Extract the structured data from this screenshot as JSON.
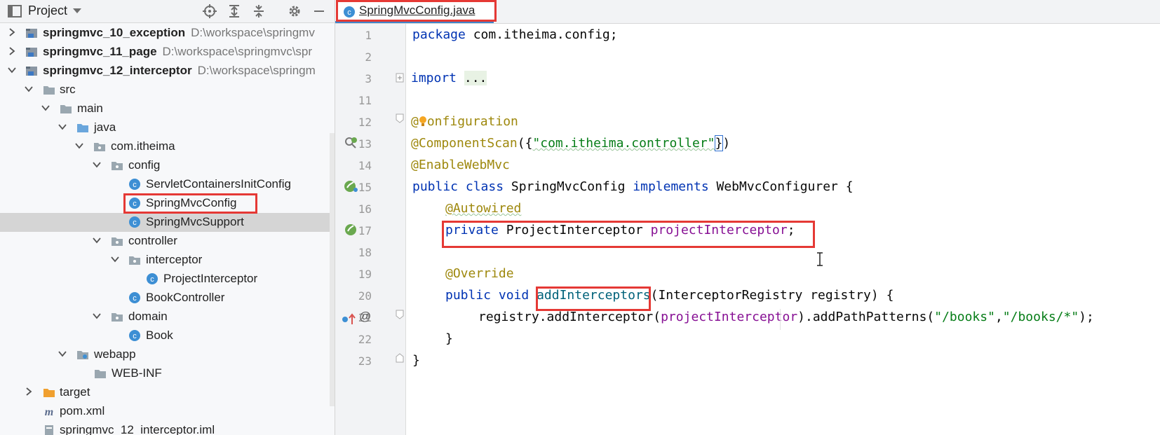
{
  "project_panel": {
    "title": "Project",
    "tree": [
      {
        "label": "springmvc_10_exception",
        "path": "D:\\workspace\\springmv",
        "bold": true
      },
      {
        "label": "springmvc_11_page",
        "path": "D:\\workspace\\springmvc\\spr",
        "bold": true
      },
      {
        "label": "springmvc_12_interceptor",
        "path": "D:\\workspace\\springm",
        "bold": true
      },
      {
        "label": "src"
      },
      {
        "label": "main"
      },
      {
        "label": "java"
      },
      {
        "label": "com.itheima"
      },
      {
        "label": "config"
      },
      {
        "label": "ServletContainersInitConfig"
      },
      {
        "label": "SpringMvcConfig"
      },
      {
        "label": "SpringMvcSupport"
      },
      {
        "label": "controller"
      },
      {
        "label": "interceptor"
      },
      {
        "label": "ProjectInterceptor"
      },
      {
        "label": "BookController"
      },
      {
        "label": "domain"
      },
      {
        "label": "Book"
      },
      {
        "label": "webapp"
      },
      {
        "label": "WEB-INF"
      },
      {
        "label": "target"
      },
      {
        "label": "pom.xml"
      },
      {
        "label": "springmvc_12_interceptor.iml"
      }
    ]
  },
  "editor": {
    "tab_title": "SpringMvcConfig.java",
    "line_numbers": [
      "1",
      "2",
      "3",
      "11",
      "12",
      "13",
      "14",
      "15",
      "16",
      "17",
      "18",
      "19",
      "20",
      "21",
      "22",
      "23"
    ],
    "code": {
      "l1_kw": "package",
      "l1_rest": " com.itheima.config;",
      "l3_kw": "import",
      "l3_fold": "...",
      "l12_at": "@",
      "l12_rest": "onfiguration",
      "l13_ann": "@ComponentScan",
      "l13_open": "(",
      "l13_brace_open": "{",
      "l13_str": "\"com.itheima.controller\"",
      "l13_brace_close": "}",
      "l13_close": ")",
      "l14_ann": "@EnableWebMvc",
      "l15_kw1": "public class",
      "l15_name": " SpringMvcConfig ",
      "l15_kw2": "implements",
      "l15_rest": " WebMvcConfigurer {",
      "l16_ann": "@Autowired",
      "l17_kw": "private",
      "l17_type": " ProjectInterceptor ",
      "l17_fld": "projectInterceptor",
      "l17_semi": ";",
      "l19_ann": "@Override",
      "l20_kw": "public void",
      "l20_meth": "addInterceptors",
      "l20_rest": "(InterceptorRegistry registry) {",
      "l21_a": "registry.addInterceptor(",
      "l21_fld": "projectInterceptor",
      "l21_b": ").addPathPatterns(",
      "l21_s1": "\"/books\"",
      "l21_c": ",",
      "l21_s2": "\"/books/*\"",
      "l21_d": ");",
      "l22": "}",
      "l23": "}"
    }
  },
  "colors": {
    "highlight_box": "#e53935",
    "keyword": "#0033b3",
    "annotation": "#9e880d",
    "string": "#067d17",
    "field": "#871094"
  }
}
